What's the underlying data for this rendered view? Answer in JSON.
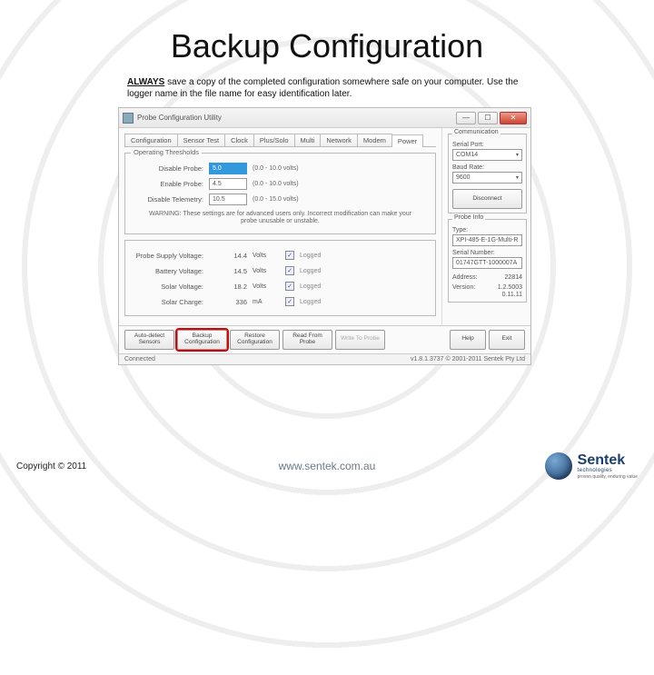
{
  "slide": {
    "title": "Backup Configuration",
    "paragraph_line1": "ALWAYS save a copy of the completed configuration somewhere safe on your computer.",
    "paragraph_line2": "Use the logger name in the file name for easy identification later.",
    "paragraph_strong": "ALWAYS"
  },
  "window": {
    "title": "Probe Configuration Utility",
    "tabs": [
      "Configuration",
      "Sensor Test",
      "Clock",
      "Plus/Solo",
      "Multi",
      "Network",
      "Modem",
      "Power"
    ],
    "active_tab_index": 7,
    "thresholds": {
      "legend": "Operating Thresholds",
      "disable_probe": {
        "label": "Disable Probe:",
        "value": "5.0",
        "hint": "(0.0 - 10.0 volts)"
      },
      "enable_probe": {
        "label": "Enable Probe:",
        "value": "4.5",
        "hint": "(0.0 - 10.0 volts)"
      },
      "disable_telemetry": {
        "label": "Disable Telemetry:",
        "value": "10.5",
        "hint": "(0.0 - 15.0 volts)"
      },
      "warning": "WARNING: These settings are for advanced users only. Incorrect modification can make your probe unusable or unstable."
    },
    "readings": [
      {
        "label": "Probe Supply Voltage:",
        "value": "14.4",
        "unit": "Volts",
        "logged": true
      },
      {
        "label": "Battery Voltage:",
        "value": "14.5",
        "unit": "Volts",
        "logged": true
      },
      {
        "label": "Solar Voltage:",
        "value": "18.2",
        "unit": "Volts",
        "logged": true
      },
      {
        "label": "Solar Charge:",
        "value": "336",
        "unit": "mA",
        "logged": true
      }
    ],
    "logged_label": "Logged",
    "buttons": {
      "auto_detect": {
        "line1": "Auto-detect",
        "line2": "Sensors"
      },
      "backup": {
        "line1": "Backup",
        "line2": "Configuration"
      },
      "restore": {
        "line1": "Restore",
        "line2": "Configuration"
      },
      "read": {
        "line1": "Read From",
        "line2": "Probe"
      },
      "write": "Write To Probe",
      "help": "Help",
      "exit": "Exit"
    },
    "status_left": "Connected",
    "status_right": "v1.8.1.3737 © 2001-2011 Sentek Pty Ltd"
  },
  "sidebar": {
    "comm_legend": "Communication",
    "serial_label": "Serial Port:",
    "serial_value": "COM14",
    "baud_label": "Baud Rate:",
    "baud_value": "9600",
    "disconnect": "Disconnect",
    "probe_legend": "Probe Info",
    "type_label": "Type:",
    "type_value": "XPI-485-E-1G-Multi-R",
    "serialno_label": "Serial Number:",
    "serialno_value": "01747GTT-1000007A",
    "address_label": "Address:",
    "address_value": "22814",
    "version_label": "Version:",
    "version_value1": "1.2.5003",
    "version_value2": "0.11.11"
  },
  "footer": {
    "copyright": "Copyright © 2011",
    "url": "www.sentek.com.au",
    "logo_main": "Sentek",
    "logo_sub": "technologies",
    "logo_tag": "proven quality, enduring value"
  },
  "icons": {
    "minimize": "—",
    "maximize": "☐",
    "close": "✕",
    "check": "✓",
    "dropdown": "▾"
  }
}
